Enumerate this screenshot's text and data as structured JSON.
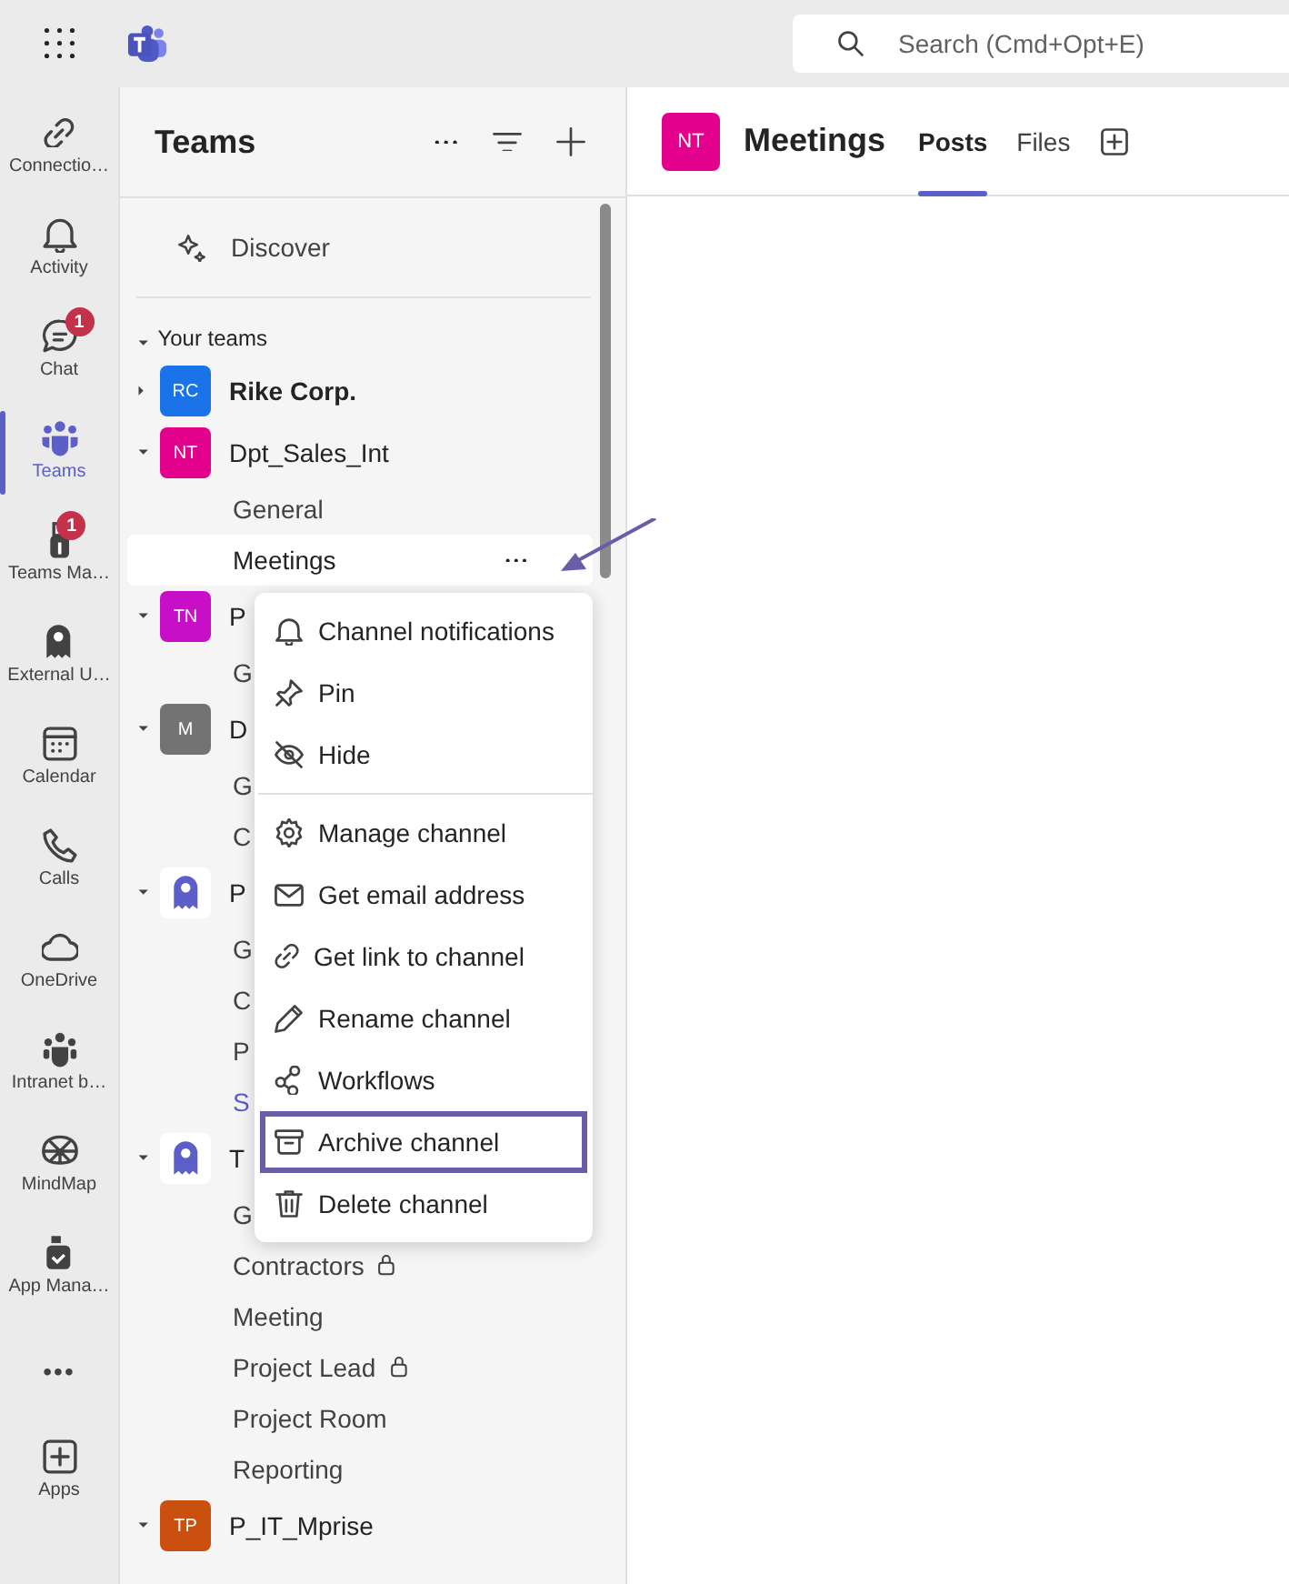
{
  "search": {
    "placeholder": "Search (Cmd+Opt+E)"
  },
  "rail": [
    {
      "label": "Connectio…",
      "kind": "app",
      "selected": false
    },
    {
      "label": "Activity",
      "kind": "app",
      "selected": false
    },
    {
      "label": "Chat",
      "kind": "app",
      "selected": false,
      "badge": "1"
    },
    {
      "label": "Teams",
      "kind": "app",
      "selected": true
    },
    {
      "label": "Teams Ma…",
      "kind": "app",
      "selected": false,
      "badge": "1"
    },
    {
      "label": "External U…",
      "kind": "app",
      "selected": false
    },
    {
      "label": "Calendar",
      "kind": "app",
      "selected": false
    },
    {
      "label": "Calls",
      "kind": "app",
      "selected": false
    },
    {
      "label": "OneDrive",
      "kind": "app",
      "selected": false
    },
    {
      "label": "Intranet b…",
      "kind": "app",
      "selected": false
    },
    {
      "label": "MindMap",
      "kind": "app",
      "selected": false
    },
    {
      "label": "App Mana…",
      "kind": "app",
      "selected": false
    },
    {
      "label": "•••",
      "kind": "more",
      "selected": false
    },
    {
      "label": "Apps",
      "kind": "app",
      "selected": false
    }
  ],
  "panel": {
    "title": "Teams",
    "discover": "Discover",
    "section": "Your teams",
    "section_expanded": true
  },
  "teams": [
    {
      "name": "Rike Corp.",
      "bold": true,
      "expanded": false,
      "avatar": {
        "kind": "initials",
        "text": "RC",
        "color": "#1a73e8"
      }
    },
    {
      "name": "Dpt_Sales_Int",
      "bold": false,
      "expanded": true,
      "avatar": {
        "kind": "initials",
        "text": "NT",
        "color": "#e3008c"
      },
      "channels": [
        {
          "name": "General",
          "selected": false,
          "unread": false,
          "private": false
        },
        {
          "name": "Meetings",
          "selected": true,
          "unread": false,
          "private": false
        }
      ]
    },
    {
      "name": "P",
      "bold": false,
      "expanded": true,
      "avatar": {
        "kind": "initials",
        "text": "TN",
        "color": "#c80fc8"
      },
      "channels": [
        {
          "name": "G",
          "selected": false,
          "unread": false
        }
      ]
    },
    {
      "name": "D",
      "bold": false,
      "expanded": true,
      "avatar": {
        "kind": "initials",
        "text": "M",
        "color": "#737373"
      },
      "channels": [
        {
          "name": "G",
          "selected": false,
          "unread": false
        },
        {
          "name": "C",
          "selected": false,
          "unread": false
        }
      ]
    },
    {
      "name": "P",
      "bold": false,
      "expanded": true,
      "avatar": {
        "kind": "bot"
      },
      "channels": [
        {
          "name": "G",
          "selected": false,
          "unread": false
        },
        {
          "name": "C",
          "selected": false,
          "unread": false
        },
        {
          "name": "P",
          "selected": false,
          "unread": false
        },
        {
          "name": "S",
          "selected": false,
          "unread": true
        }
      ]
    },
    {
      "name": "T",
      "bold": false,
      "expanded": true,
      "avatar": {
        "kind": "bot"
      },
      "channels": [
        {
          "name": "G",
          "selected": false,
          "unread": false
        },
        {
          "name": "Contractors",
          "selected": false,
          "unread": false,
          "private": true
        },
        {
          "name": "Meeting",
          "selected": false,
          "unread": false,
          "private": false
        },
        {
          "name": "Project Lead",
          "selected": false,
          "unread": false,
          "private": true
        },
        {
          "name": "Project Room",
          "selected": false,
          "unread": false,
          "private": false
        },
        {
          "name": "Reporting",
          "selected": false,
          "unread": false,
          "private": false
        }
      ]
    },
    {
      "name": "P_IT_Mprise",
      "bold": false,
      "expanded": true,
      "avatar": {
        "kind": "initials",
        "text": "TP",
        "color": "#ca5010"
      }
    }
  ],
  "header": {
    "avatar": "NT",
    "title": "Meetings",
    "tabs": [
      {
        "label": "Posts",
        "selected": true
      },
      {
        "label": "Files",
        "selected": false
      }
    ]
  },
  "menu": [
    [
      {
        "label": "Channel notifications",
        "highlighted": false
      },
      {
        "label": "Pin",
        "highlighted": false
      },
      {
        "label": "Hide",
        "highlighted": false
      }
    ],
    [
      {
        "label": "Manage channel",
        "highlighted": false
      },
      {
        "label": "Get email address",
        "highlighted": false
      },
      {
        "label": "Get link to channel",
        "highlighted": false
      },
      {
        "label": "Rename channel",
        "highlighted": false
      },
      {
        "label": "Workflows",
        "highlighted": false
      },
      {
        "label": "Archive channel",
        "highlighted": true
      },
      {
        "label": "Delete channel",
        "highlighted": false
      }
    ]
  ]
}
